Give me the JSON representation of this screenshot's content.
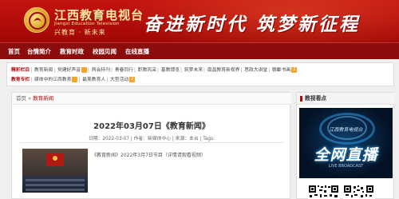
{
  "header": {
    "logo_name_cn": "江西教育电视台",
    "logo_name_en": "Jiangxi Education Television",
    "logo_slogan": "兴教育 · 新未来",
    "slogan": "奋进新时代  筑梦新征程"
  },
  "nav": {
    "items": [
      "首页",
      "台情简介",
      "教育时政",
      "校园见闻",
      "在线直播"
    ]
  },
  "channels": {
    "featured_title": "精彩栏目",
    "featured_items": [
      "教育新闻",
      "党建好声音",
      "两会特刊",
      "青春同行",
      "职教风采",
      "基教博览",
      "筑梦未来",
      "南昌教育新视界",
      "思政大讲堂",
      "赣鄱书画"
    ],
    "featured_badges": {
      "党建好声音": "",
      "赣鄱书画": "1"
    },
    "special_title": "教育专栏",
    "special_items": [
      "媒体中的江西教育",
      "最美教育人",
      "大型活动"
    ],
    "special_badges": {
      "媒体中的江西教育": "",
      "大型活动": "2"
    }
  },
  "breadcrumb": {
    "home": "首页",
    "separator": "»",
    "current": "教育新闻"
  },
  "article": {
    "title": "2022年03月07日《教育新闻》",
    "meta": "日期：2022-03-07 | 作者：新媒体中心 | 来源：本台 | Tags:",
    "summary": "《教育新闻》2022年3月7日节目（详情请观看视频）"
  },
  "sidebar": {
    "title": "教视看点",
    "promo_big": "全网直播",
    "promo_small": "江西教育电视台",
    "promo_sub": "LIVE BROADCAST"
  },
  "colors": {
    "brand_red": "#b10d0c",
    "nav_red": "#8a0d0c",
    "gold": "#ffe9a0",
    "badge_orange": "#f3a42b"
  }
}
